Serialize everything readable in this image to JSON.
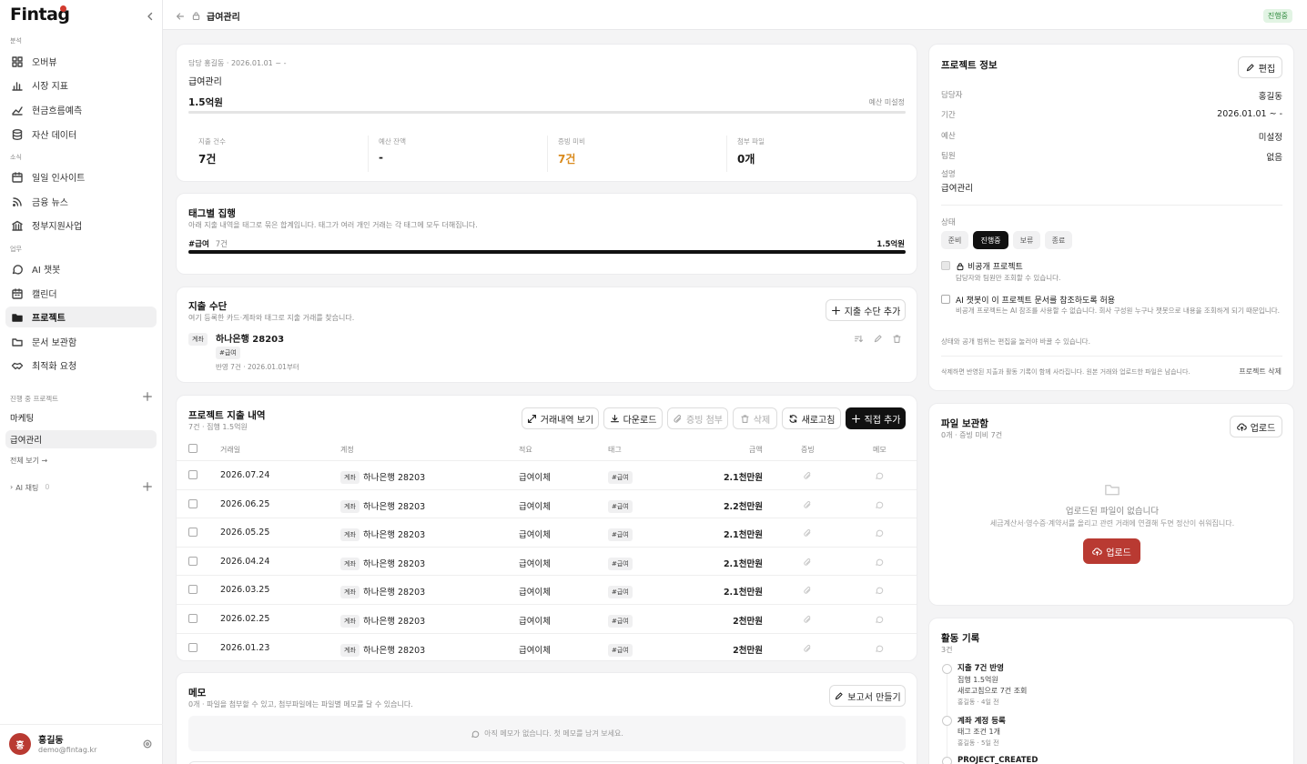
{
  "app": {
    "logo": "Fintag"
  },
  "sidebar": {
    "sections": {
      "analysis": "분석",
      "news": "소식",
      "work": "업무"
    },
    "analysis_items": [
      {
        "label": "오버뷰",
        "icon": "grid-icon"
      },
      {
        "label": "시장 지표",
        "icon": "bar-chart-icon"
      },
      {
        "label": "현금흐름예측",
        "icon": "trend-icon"
      },
      {
        "label": "자산 데이터",
        "icon": "database-icon"
      }
    ],
    "news_items": [
      {
        "label": "일일 인사이트",
        "icon": "calendar-insight-icon"
      },
      {
        "label": "금융 뉴스",
        "icon": "rss-icon"
      },
      {
        "label": "정부지원사업",
        "icon": "bank-icon"
      }
    ],
    "work_items": [
      {
        "label": "AI 챗봇",
        "icon": "chat-icon"
      },
      {
        "label": "캘린더",
        "icon": "calendar-icon"
      },
      {
        "label": "프로젝트",
        "icon": "folder-icon"
      },
      {
        "label": "문서 보관함",
        "icon": "folder-open-icon"
      },
      {
        "label": "최적화 요청",
        "icon": "handshake-icon"
      }
    ],
    "projects_header": "진행 중 프로젝트",
    "projects": [
      "마케팅",
      "급여관리"
    ],
    "view_all": "전체 보기 →",
    "ai_chat": "AI 채팅",
    "ai_chat_count": "0",
    "user": {
      "initial": "홍",
      "name": "홍길동",
      "email": "demo@fintag.kr"
    }
  },
  "topbar": {
    "title": "급여관리",
    "status": "진행중"
  },
  "summary": {
    "meta": "담당 홍길동 · 2026.01.01 ~ -",
    "name": "급여관리",
    "amount": "1.5억원",
    "budget_note": "예산 미설정",
    "progress": 1.0,
    "stats": [
      {
        "label": "지출 건수",
        "value": "7건"
      },
      {
        "label": "예산 잔액",
        "value": "-"
      },
      {
        "label": "증빙 미비",
        "value": "7건"
      },
      {
        "label": "첨부 파일",
        "value": "0개"
      }
    ]
  },
  "tags": {
    "title": "태그별 집행",
    "desc": "아래 지출 내역을 태그로 묶은 합계입니다. 태그가 여러 개인 거래는 각 태그에 모두 더해집니다.",
    "items": [
      {
        "name": "#급여",
        "count": "7건",
        "amount": "1.5억원",
        "ratio": 1.0
      }
    ]
  },
  "methods": {
    "title": "지출 수단",
    "desc": "여기 등록한 카드·계좌와 태그로 지출 거래를 찾습니다.",
    "add_label": "지출 수단 추가",
    "items": [
      {
        "type": "계좌",
        "name": "하나은행 28203",
        "tag": "#급여",
        "meta": "반영 7건 · 2026.01.01부터"
      }
    ]
  },
  "expenses": {
    "title": "프로젝트 지출 내역",
    "sub": "7건 · 집행 1.5억원",
    "buttons": {
      "view": "거래내역 보기",
      "download": "다운로드",
      "attach": "증빙 첨부",
      "delete": "삭제",
      "refresh": "새로고침",
      "add": "직접 추가"
    },
    "columns": [
      "거래일",
      "계정",
      "적요",
      "태그",
      "금액",
      "증빙",
      "메모"
    ],
    "rows": [
      {
        "date": "2026.07.24",
        "type": "계좌",
        "account": "하나은행 28203",
        "memo": "급여이체",
        "tag": "#급여",
        "amount": "2.1천만원"
      },
      {
        "date": "2026.06.25",
        "type": "계좌",
        "account": "하나은행 28203",
        "memo": "급여이체",
        "tag": "#급여",
        "amount": "2.2천만원"
      },
      {
        "date": "2026.05.25",
        "type": "계좌",
        "account": "하나은행 28203",
        "memo": "급여이체",
        "tag": "#급여",
        "amount": "2.1천만원"
      },
      {
        "date": "2026.04.24",
        "type": "계좌",
        "account": "하나은행 28203",
        "memo": "급여이체",
        "tag": "#급여",
        "amount": "2.1천만원"
      },
      {
        "date": "2026.03.25",
        "type": "계좌",
        "account": "하나은행 28203",
        "memo": "급여이체",
        "tag": "#급여",
        "amount": "2.1천만원"
      },
      {
        "date": "2026.02.25",
        "type": "계좌",
        "account": "하나은행 28203",
        "memo": "급여이체",
        "tag": "#급여",
        "amount": "2천만원"
      },
      {
        "date": "2026.01.23",
        "type": "계좌",
        "account": "하나은행 28203",
        "memo": "급여이체",
        "tag": "#급여",
        "amount": "2천만원"
      }
    ]
  },
  "memo": {
    "title": "메모",
    "desc": "0개 · 파일을 첨부할 수 있고, 첨부파일에는 파일별 메모를 달 수 있습니다.",
    "report_label": "보고서 만들기",
    "empty": "아직 메모가 없습니다. 첫 메모를 남겨 보세요."
  },
  "info": {
    "title": "프로젝트 정보",
    "edit_label": "편집",
    "rows": [
      {
        "key": "담당자",
        "value": "홍길동"
      },
      {
        "key": "기간",
        "value": "2026.01.01 ~ -"
      },
      {
        "key": "예산",
        "value": "미설정"
      },
      {
        "key": "팀원",
        "value": "없음"
      }
    ],
    "desc_key": "설명",
    "desc_value": "급여관리",
    "status_key": "상태",
    "statuses": [
      "준비",
      "진행중",
      "보류",
      "종료"
    ],
    "status_active": "진행중",
    "private_label": "비공개 프로젝트",
    "private_desc": "담당자와 팀원만 조회할 수 있습니다.",
    "ai_label": "AI 챗봇이 이 프로젝트 문서를 참조하도록 허용",
    "ai_desc": "비공개 프로젝트는 AI 참조를 사용할 수 없습니다. 회사 구성원 누구나 챗봇으로 내용을 조회하게 되기 때문입니다.",
    "edit_note": "상태와 공개 범위는 편집을 눌러야 바꿀 수 있습니다.",
    "delete_note": "삭제하면 반영된 지출과 활동 기록이 함께 사라집니다. 원본 거래와 업로드한 파일은 남습니다.",
    "delete_label": "프로젝트 삭제"
  },
  "files": {
    "title": "파일 보관함",
    "sub": "0개 · 증빙 미비 7건",
    "upload_label": "업로드",
    "empty_title": "업로드된 파일이 없습니다",
    "empty_desc": "세금계산서·영수증·계약서를 올리고 관련 거래에 연결해 두면 정산이 쉬워집니다.",
    "cta_label": "업로드"
  },
  "activity": {
    "title": "활동 기록",
    "sub": "3건",
    "items": [
      {
        "title": "지출 7건 반영",
        "lines": [
          "집행 1.5억원",
          "새로고침으로 7건 조회"
        ],
        "meta": "홍길동 · 4일 전"
      },
      {
        "title": "계좌 계정 등록",
        "lines": [
          "태그 조건 1개"
        ],
        "meta": "홍길동 · 5일 전"
      },
      {
        "title": "PROJECT_CREATED",
        "lines": [],
        "meta": ""
      }
    ]
  },
  "colors": {
    "accent": "#b93a32",
    "warning": "#d98a1c",
    "status_green": "#2f8a3e"
  }
}
